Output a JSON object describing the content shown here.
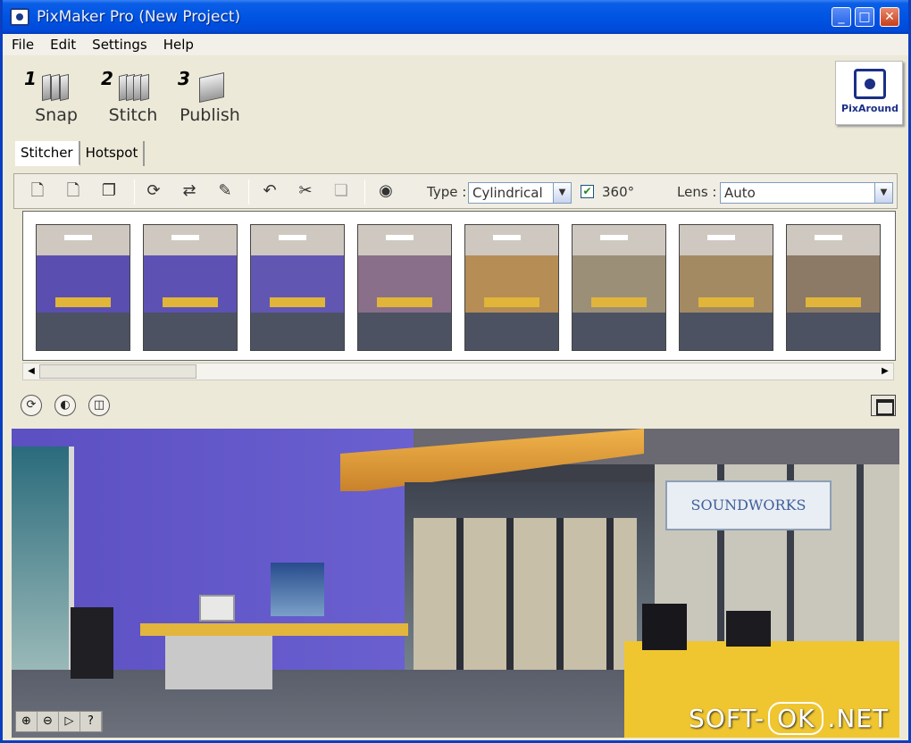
{
  "window": {
    "title": "PixMaker Pro (New Project)"
  },
  "menu": [
    "File",
    "Edit",
    "Settings",
    "Help"
  ],
  "steps": [
    {
      "num": "1",
      "label": "Snap"
    },
    {
      "num": "2",
      "label": "Stitch"
    },
    {
      "num": "3",
      "label": "Publish"
    }
  ],
  "logo": {
    "text": "PixAround"
  },
  "tabs": [
    "Stitcher",
    "Hotspot"
  ],
  "toolbar": {
    "type_label": "Type :",
    "type_value": "Cylindrical",
    "checkbox_360_checked": true,
    "label_360": "360°",
    "lens_label": "Lens :",
    "lens_value": "Auto"
  },
  "thumbnails": [
    {
      "wall": "#5a4fb0"
    },
    {
      "wall": "#5d52b4"
    },
    {
      "wall": "#6157b3"
    },
    {
      "wall": "#8a6f8a"
    },
    {
      "wall": "#b58d55"
    },
    {
      "wall": "#9c8f78"
    },
    {
      "wall": "#a38a62"
    },
    {
      "wall": "#8c7a66"
    }
  ],
  "preview": {
    "sign_text": "SOUNDWORKS"
  },
  "watermark": {
    "left": "SOFT-",
    "mid": "OK",
    "right": ".NET"
  }
}
